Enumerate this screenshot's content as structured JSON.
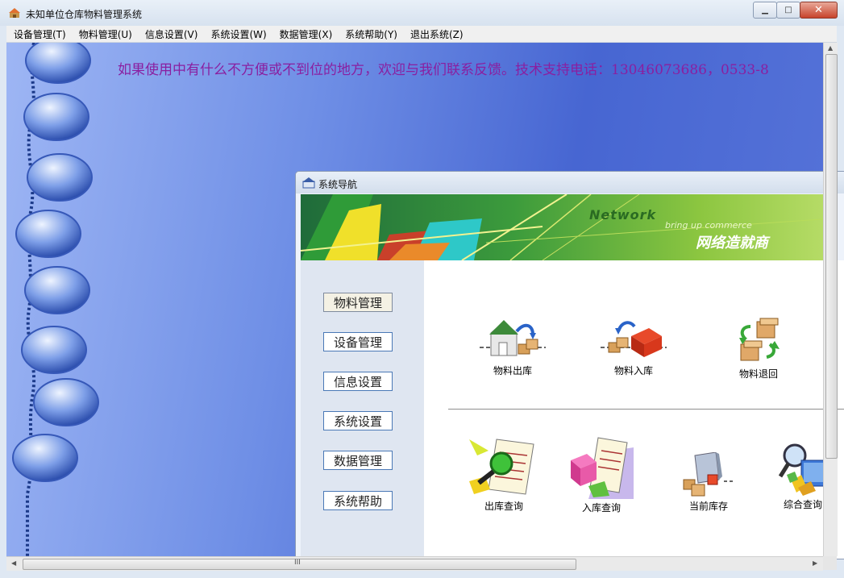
{
  "window": {
    "title": "未知单位仓库物料管理系统",
    "controls": {
      "minimize": "▁",
      "maximize": "□",
      "close": "✕"
    }
  },
  "menu": {
    "items": [
      {
        "label": "设备管理(T)"
      },
      {
        "label": "物料管理(U)"
      },
      {
        "label": "信息设置(V)"
      },
      {
        "label": "系统设置(W)"
      },
      {
        "label": "数据管理(X)"
      },
      {
        "label": "系统帮助(Y)"
      },
      {
        "label": "退出系统(Z)"
      }
    ]
  },
  "marquee": {
    "text": "如果使用中有什么不方便或不到位的地方，欢迎与我们联系反馈。技术支持电话：13046073686，0533-8"
  },
  "nav_window": {
    "title": "系统导航",
    "banner": {
      "line1": "Network",
      "line2": "bring up commerce",
      "line3": "网络造就商"
    },
    "buttons": [
      {
        "label": "物料管理",
        "active": true
      },
      {
        "label": "设备管理"
      },
      {
        "label": "信息设置"
      },
      {
        "label": "系统设置"
      },
      {
        "label": "数据管理"
      },
      {
        "label": "系统帮助"
      }
    ],
    "tiles_top": [
      {
        "label": "物料出库",
        "icon": "outbound-icon"
      },
      {
        "label": "物料入库",
        "icon": "inbound-icon"
      },
      {
        "label": "物料退回",
        "icon": "return-icon"
      }
    ],
    "tiles_bottom": [
      {
        "label": "出库查询",
        "icon": "outbound-query-icon"
      },
      {
        "label": "入库查询",
        "icon": "inbound-query-icon"
      },
      {
        "label": "当前库存",
        "icon": "inventory-icon"
      },
      {
        "label": "综合查询",
        "icon": "general-query-icon"
      }
    ]
  },
  "scrollbar": {
    "grip": "III"
  }
}
